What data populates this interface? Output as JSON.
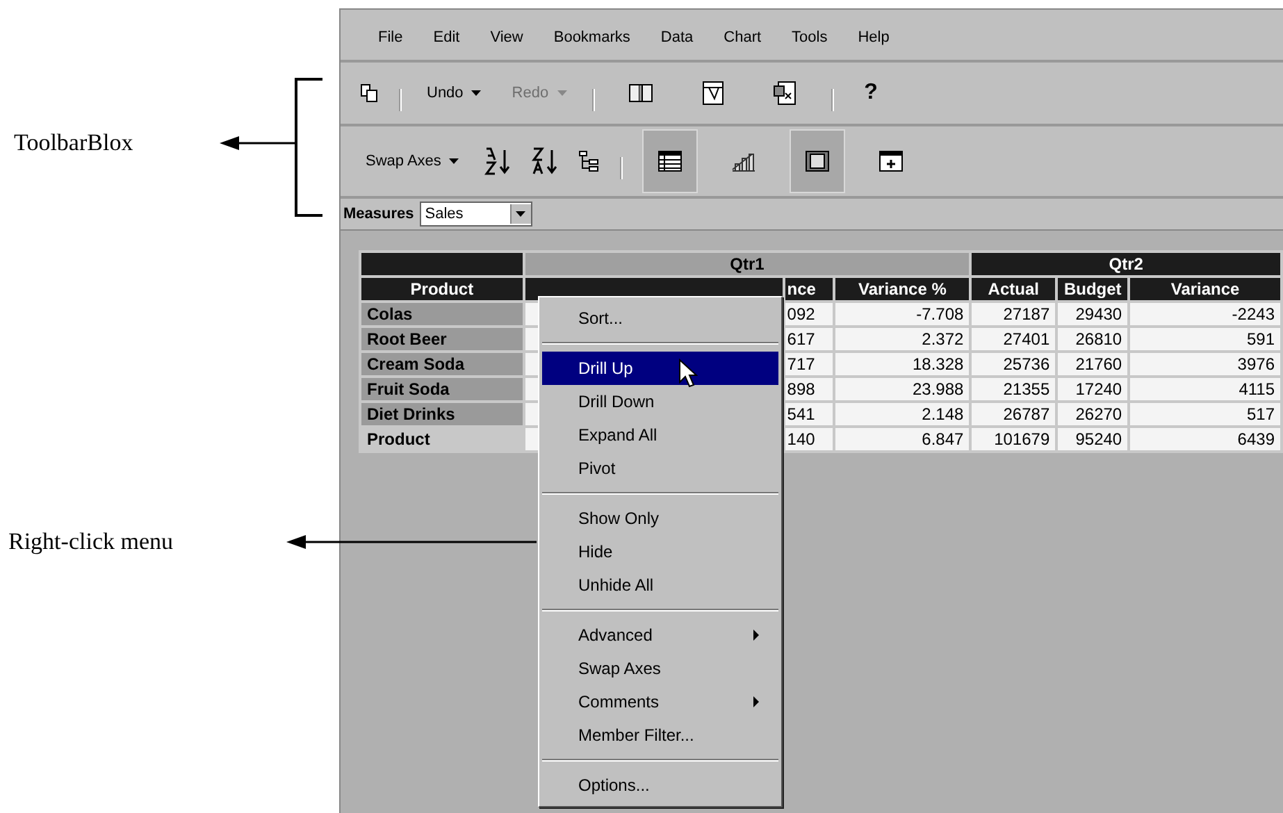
{
  "callouts": [
    {
      "label": "ToolbarBlox"
    },
    {
      "label": "Right-click menu"
    }
  ],
  "menu_bar": [
    "File",
    "Edit",
    "View",
    "Bookmarks",
    "Data",
    "Chart",
    "Tools",
    "Help"
  ],
  "toolbar_1": {
    "undo": {
      "label": "Undo",
      "disabled": false
    },
    "redo": {
      "label": "Redo",
      "disabled": true
    },
    "help": "?"
  },
  "toolbar_2": {
    "swap_axes": "Swap Axes",
    "view_buttons": [
      {
        "selected": true
      },
      {
        "selected": false
      },
      {
        "selected": true
      },
      {
        "selected": false
      }
    ]
  },
  "measures": {
    "label": "Measures",
    "value": "Sales"
  },
  "table": {
    "groups": [
      "Qtr1",
      "Qtr2"
    ],
    "product_header": "Product",
    "columns": [
      "nce",
      "Variance %",
      "Actual",
      "Budget",
      "Variance"
    ],
    "rows": [
      {
        "product": "Colas",
        "kind": "member",
        "cells": [
          "092",
          "-7.708",
          "27187",
          "29430",
          "-2243"
        ]
      },
      {
        "product": "Root Beer",
        "kind": "member",
        "cells": [
          "617",
          "2.372",
          "27401",
          "26810",
          "591"
        ]
      },
      {
        "product": "Cream Soda",
        "kind": "member",
        "cells": [
          "717",
          "18.328",
          "25736",
          "21760",
          "3976"
        ]
      },
      {
        "product": "Fruit Soda",
        "kind": "member",
        "cells": [
          "898",
          "23.988",
          "21355",
          "17240",
          "4115"
        ]
      },
      {
        "product": "Diet Drinks",
        "kind": "member",
        "cells": [
          "541",
          "2.148",
          "26787",
          "26270",
          "517"
        ]
      },
      {
        "product": "Product",
        "kind": "total",
        "cells": [
          "140",
          "6.847",
          "101679",
          "95240",
          "6439"
        ]
      }
    ]
  },
  "context_menu": [
    [
      {
        "label": "Sort...",
        "selected": false,
        "submenu": false
      }
    ],
    [
      {
        "label": "Drill Up",
        "selected": true,
        "submenu": false
      },
      {
        "label": "Drill Down",
        "selected": false,
        "submenu": false
      },
      {
        "label": "Expand All",
        "selected": false,
        "submenu": false
      },
      {
        "label": "Pivot",
        "selected": false,
        "submenu": false
      }
    ],
    [
      {
        "label": "Show Only",
        "selected": false,
        "submenu": false
      },
      {
        "label": "Hide",
        "selected": false,
        "submenu": false
      },
      {
        "label": "Unhide All",
        "selected": false,
        "submenu": false
      }
    ],
    [
      {
        "label": "Advanced",
        "selected": false,
        "submenu": true
      },
      {
        "label": "Swap Axes",
        "selected": false,
        "submenu": false
      },
      {
        "label": "Comments",
        "selected": false,
        "submenu": true
      },
      {
        "label": "Member Filter...",
        "selected": false,
        "submenu": false
      }
    ],
    [
      {
        "label": "Options...",
        "selected": false,
        "submenu": false
      }
    ]
  ]
}
